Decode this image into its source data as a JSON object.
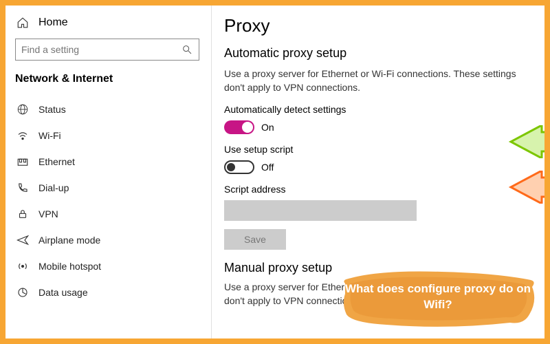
{
  "sidebar": {
    "home": "Home",
    "search_placeholder": "Find a setting",
    "category": "Network & Internet",
    "items": [
      {
        "label": "Status"
      },
      {
        "label": "Wi-Fi"
      },
      {
        "label": "Ethernet"
      },
      {
        "label": "Dial-up"
      },
      {
        "label": "VPN"
      },
      {
        "label": "Airplane mode"
      },
      {
        "label": "Mobile hotspot"
      },
      {
        "label": "Data usage"
      }
    ]
  },
  "main": {
    "title": "Proxy",
    "auto_section": "Automatic proxy setup",
    "auto_desc": "Use a proxy server for Ethernet or Wi-Fi connections. These settings don't apply to VPN connections.",
    "auto_detect_label": "Automatically detect settings",
    "auto_detect_state": "On",
    "setup_script_label": "Use setup script",
    "setup_script_state": "Off",
    "script_address_label": "Script address",
    "save": "Save",
    "manual_section": "Manual proxy setup",
    "manual_desc": "Use a proxy server for Ethernet or Wi-Fi connections. These settings don't apply to VPN connections."
  },
  "overlay": {
    "caption": "What does configure proxy do on Wifi?"
  }
}
